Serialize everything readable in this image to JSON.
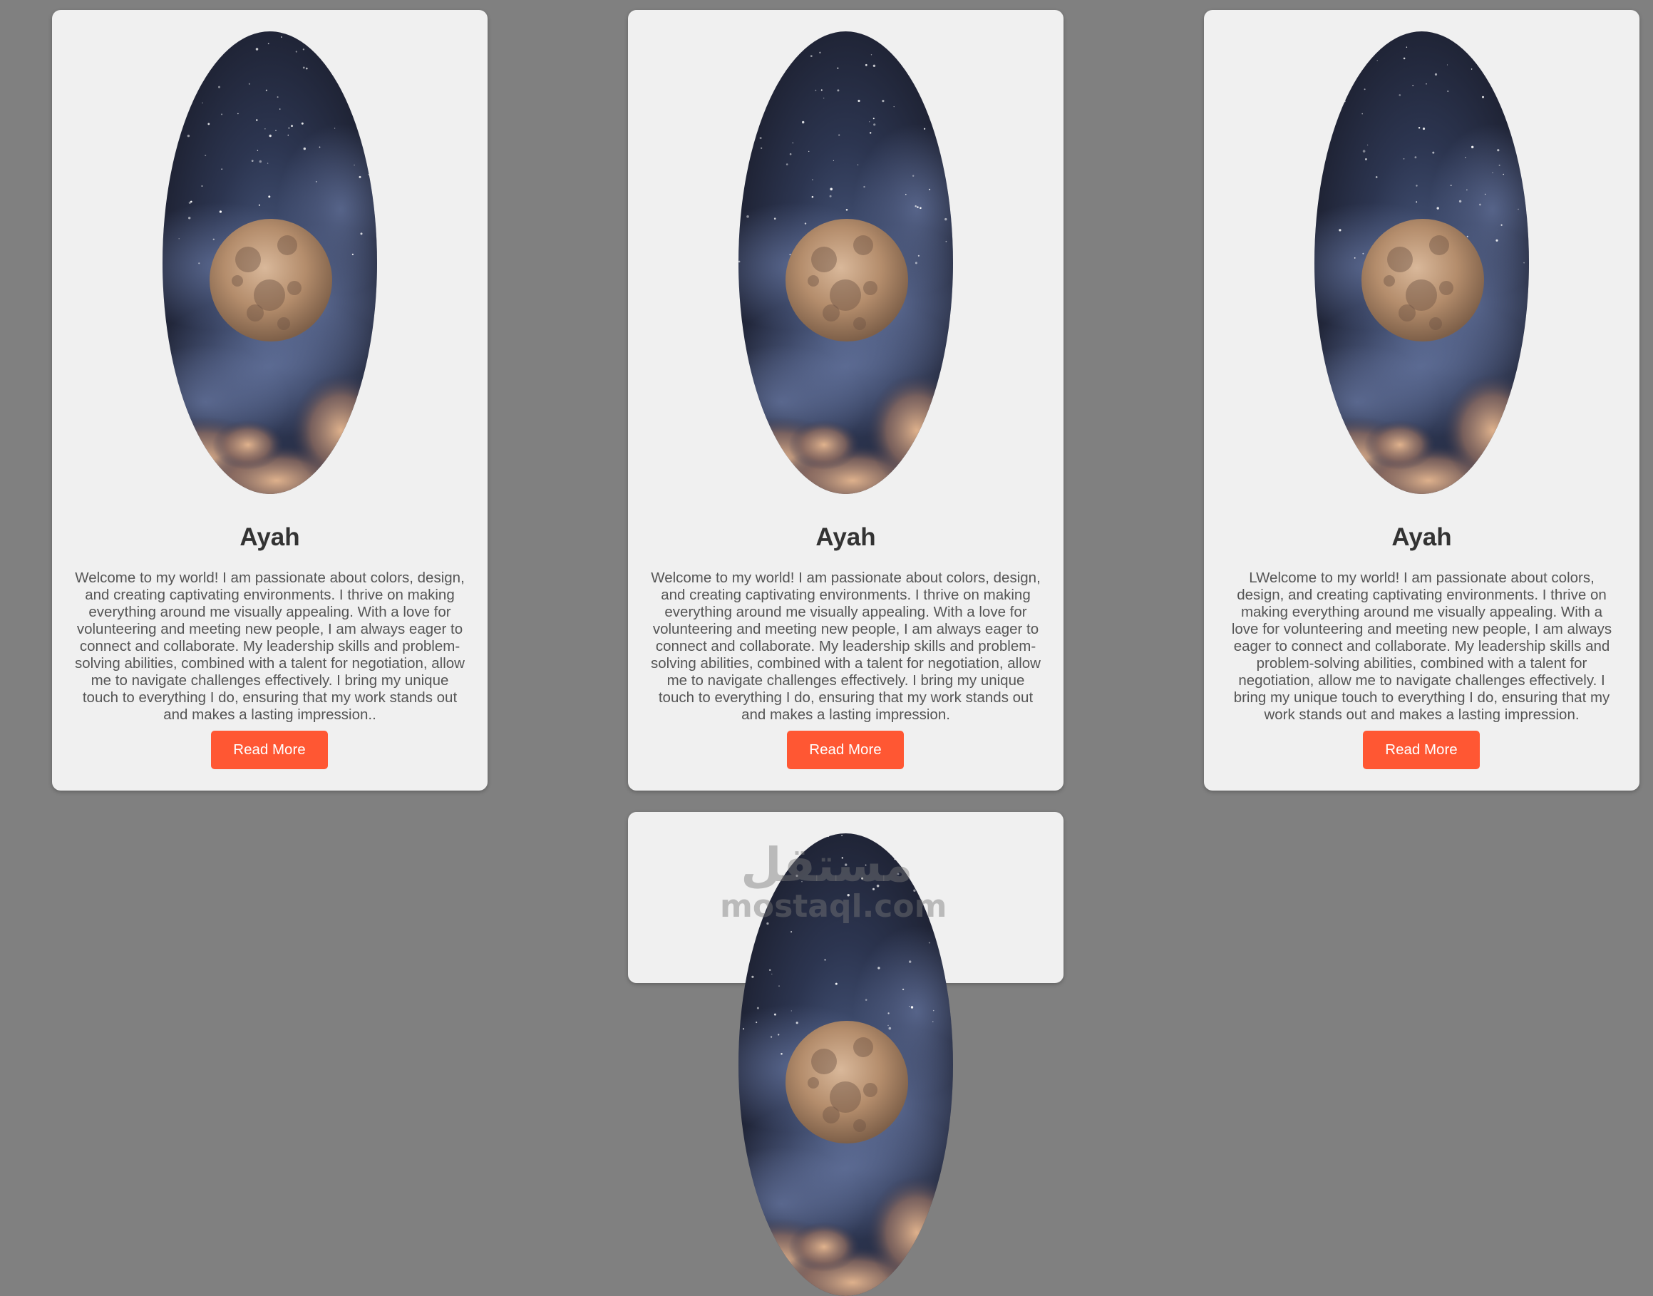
{
  "cards": [
    {
      "name": "Ayah",
      "bio": "Welcome to my world! I am passionate about colors, design, and creating captivating environments. I thrive on making everything around me visually appealing. With a love for volunteering and meeting new people, I am always eager to connect and collaborate. My leadership skills and problem-solving abilities, combined with a talent for negotiation, allow me to navigate challenges effectively. I bring my unique touch to everything I do, ensuring that my work stands out and makes a lasting impression..",
      "button_label": "Read More",
      "image": "moon-night-sky"
    },
    {
      "name": "Ayah",
      "bio": "Welcome to my world! I am passionate about colors, design, and creating captivating environments. I thrive on making everything around me visually appealing. With a love for volunteering and meeting new people, I am always eager to connect and collaborate. My leadership skills and problem-solving abilities, combined with a talent for negotiation, allow me to navigate challenges effectively. I bring my unique touch to everything I do, ensuring that my work stands out and makes a lasting impression.",
      "button_label": "Read More",
      "image": "moon-night-sky"
    },
    {
      "name": "Ayah",
      "bio": "LWelcome to my world! I am passionate about colors, design, and creating captivating environments. I thrive on making everything around me visually appealing. With a love for volunteering and meeting new people, I am always eager to connect and collaborate. My leadership skills and problem-solving abilities, combined with a talent for negotiation, allow me to navigate challenges effectively. I bring my unique touch to everything I do, ensuring that my work stands out and makes a lasting impression.",
      "button_label": "Read More",
      "image": "moon-night-sky"
    },
    {
      "image": "moon-night-sky"
    }
  ],
  "watermark": {
    "arabic": "مستقل",
    "latin": "mostaql.com"
  },
  "colors": {
    "page_background": "#808080",
    "card_background": "#f0f0f0",
    "button": "#ff5733",
    "name_text": "#333333",
    "bio_text": "#555555"
  }
}
